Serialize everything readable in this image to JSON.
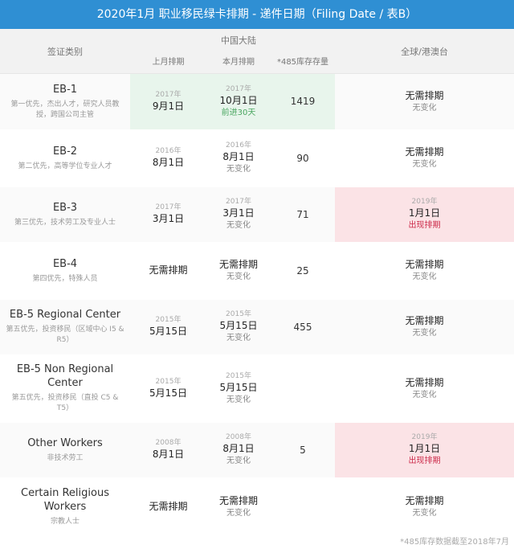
{
  "title": "2020年1月 职业移民绿卡排期 - 递件日期（Filing Date / 表B）",
  "header": {
    "visa_type": "签证类别",
    "mainland_group": "中国大陆",
    "last_month": "上月排期",
    "this_month": "本月排期",
    "inventory": "*485库存存量",
    "global": "全球/港澳台"
  },
  "rows": [
    {
      "name": "EB-1",
      "desc": "第一优先，杰出人才，研究人员教授，跨国公司主管",
      "last_year": "2017年",
      "last_date": "9月1日",
      "this_year": "2017年",
      "this_date": "10月1日",
      "this_status": "前进30天",
      "inventory": "1419",
      "global_year": "",
      "global_date": "无需排期",
      "global_status": "无变化"
    },
    {
      "name": "EB-2",
      "desc": "第二优先，高等学位专业人才",
      "last_year": "2016年",
      "last_date": "8月1日",
      "this_year": "2016年",
      "this_date": "8月1日",
      "this_status": "无变化",
      "inventory": "90",
      "global_year": "",
      "global_date": "无需排期",
      "global_status": "无变化"
    },
    {
      "name": "EB-3",
      "desc": "第三优先，技术劳工及专业人士",
      "last_year": "2017年",
      "last_date": "3月1日",
      "this_year": "2017年",
      "this_date": "3月1日",
      "this_status": "无变化",
      "inventory": "71",
      "global_year": "2019年",
      "global_date": "1月1日",
      "global_status": "出现排期"
    },
    {
      "name": "EB-4",
      "desc": "第四优先，特殊人员",
      "last_year": "",
      "last_date": "无需排期",
      "this_year": "",
      "this_date": "无需排期",
      "this_status": "无变化",
      "inventory": "25",
      "global_year": "",
      "global_date": "无需排期",
      "global_status": "无变化"
    },
    {
      "name": "EB-5 Regional Center",
      "desc": "第五优先，投资移民（区域中心 I5 & R5）",
      "last_year": "2015年",
      "last_date": "5月15日",
      "this_year": "2015年",
      "this_date": "5月15日",
      "this_status": "无变化",
      "inventory": "455",
      "global_year": "",
      "global_date": "无需排期",
      "global_status": "无变化"
    },
    {
      "name": "EB-5 Non Regional Center",
      "desc": "第五优先，投资移民（直投 C5 & T5）",
      "last_year": "2015年",
      "last_date": "5月15日",
      "this_year": "2015年",
      "this_date": "5月15日",
      "this_status": "无变化",
      "inventory": "",
      "global_year": "",
      "global_date": "无需排期",
      "global_status": "无变化"
    },
    {
      "name": "Other Workers",
      "desc": "非技术劳工",
      "last_year": "2008年",
      "last_date": "8月1日",
      "this_year": "2008年",
      "this_date": "8月1日",
      "this_status": "无变化",
      "inventory": "5",
      "global_year": "2019年",
      "global_date": "1月1日",
      "global_status": "出现排期"
    },
    {
      "name": "Certain Religious Workers",
      "desc": "宗教人士",
      "last_year": "",
      "last_date": "无需排期",
      "this_year": "",
      "this_date": "无需排期",
      "this_status": "无变化",
      "inventory": "",
      "global_year": "",
      "global_date": "无需排期",
      "global_status": "无变化"
    }
  ],
  "colors": {
    "header_bar": "#2f8fd3",
    "advance": "#4aa660",
    "retrogress": "#cc2b4a",
    "highlight_green": "#e8f5ec",
    "highlight_pink": "#fbe3e6"
  },
  "footnote": "*485库存数据截至2018年7月"
}
